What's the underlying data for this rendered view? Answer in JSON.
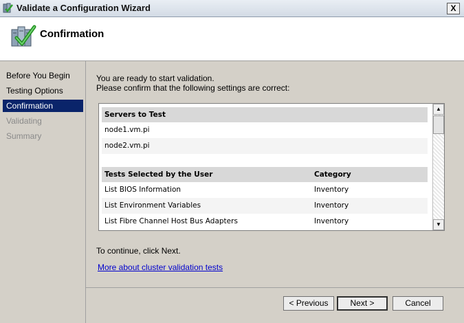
{
  "window": {
    "title": "Validate a Configuration Wizard",
    "close_glyph": "X"
  },
  "header": {
    "title": "Confirmation",
    "icon": "server-checkmark-icon"
  },
  "nav": {
    "items": [
      {
        "label": "Before You Begin",
        "state": "normal"
      },
      {
        "label": "Testing Options",
        "state": "normal"
      },
      {
        "label": "Confirmation",
        "state": "active"
      },
      {
        "label": "Validating",
        "state": "disabled"
      },
      {
        "label": "Summary",
        "state": "disabled"
      }
    ]
  },
  "content": {
    "intro_line1": "You are ready to start validation.",
    "intro_line2": "Please confirm that the following settings are correct:",
    "servers_header": "Servers to Test",
    "servers": [
      "node1.vm.pi",
      "node2.vm.pi"
    ],
    "tests_header": "Tests Selected by the User",
    "category_header": "Category",
    "tests": [
      {
        "name": "List BIOS Information",
        "category": "Inventory"
      },
      {
        "name": "List Environment Variables",
        "category": "Inventory"
      },
      {
        "name": "List Fibre Channel Host Bus Adapters",
        "category": "Inventory"
      }
    ],
    "continue_text": "To continue, click Next.",
    "link_text": "More about cluster validation tests"
  },
  "buttons": {
    "previous": "< Previous",
    "next": "Next >",
    "cancel": "Cancel"
  },
  "colors": {
    "nav_active": "#0a246a",
    "panel": "#d4d0c8",
    "link": "#0000cc"
  }
}
